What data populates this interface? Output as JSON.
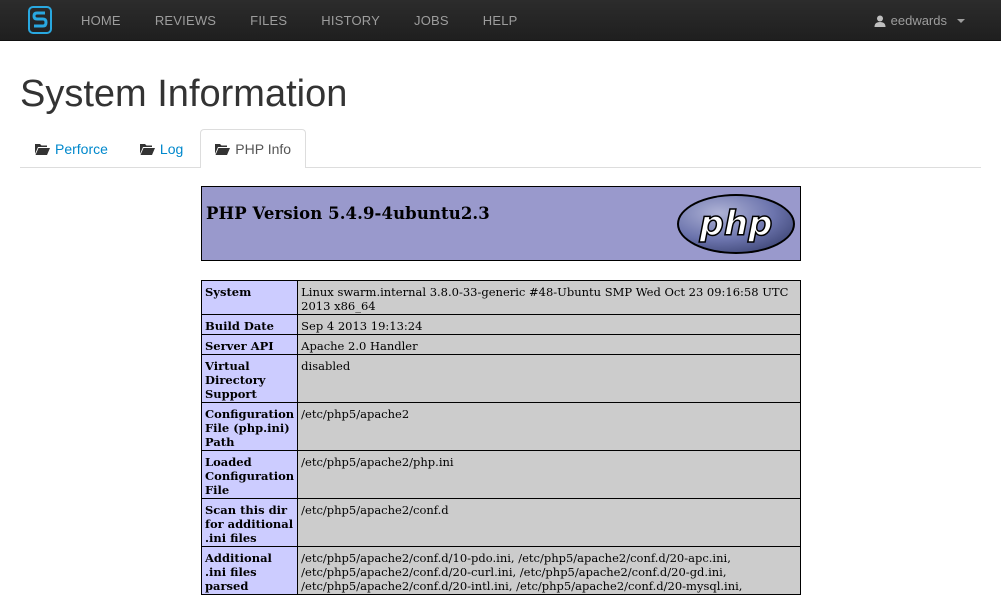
{
  "navbar": {
    "brand": "Swarm",
    "items": [
      "HOME",
      "REVIEWS",
      "FILES",
      "HISTORY",
      "JOBS",
      "HELP"
    ],
    "user": "eedwards"
  },
  "page": {
    "title": "System Information"
  },
  "tabs": [
    {
      "label": "Perforce",
      "icon": "folder-open-icon",
      "active": false
    },
    {
      "label": "Log",
      "icon": "folder-open-icon",
      "active": false
    },
    {
      "label": "PHP Info",
      "icon": "folder-open-icon",
      "active": true
    }
  ],
  "phpinfo": {
    "version_title": "PHP Version 5.4.9-4ubuntu2.3",
    "logo_text": "php",
    "rows": [
      {
        "key": "System",
        "value": "Linux swarm.internal 3.8.0-33-generic #48-Ubuntu SMP Wed Oct 23 09:16:58 UTC 2013 x86_64"
      },
      {
        "key": "Build Date",
        "value": "Sep 4 2013 19:13:24"
      },
      {
        "key": "Server API",
        "value": "Apache 2.0 Handler"
      },
      {
        "key": "Virtual Directory Support",
        "value": "disabled"
      },
      {
        "key": "Configuration File (php.ini) Path",
        "value": "/etc/php5/apache2"
      },
      {
        "key": "Loaded Configuration File",
        "value": "/etc/php5/apache2/php.ini"
      },
      {
        "key": "Scan this dir for additional .ini files",
        "value": "/etc/php5/apache2/conf.d"
      },
      {
        "key": "Additional .ini files parsed",
        "value": "/etc/php5/apache2/conf.d/10-pdo.ini, /etc/php5/apache2/conf.d/20-apc.ini, /etc/php5/apache2/conf.d/20-curl.ini, /etc/php5/apache2/conf.d/20-gd.ini, /etc/php5/apache2/conf.d/20-intl.ini, /etc/php5/apache2/conf.d/20-mysql.ini,"
      }
    ]
  },
  "colors": {
    "navbar_bg": "#222222",
    "link": "#0088cc",
    "php_header_bg": "#9999cc",
    "php_key_bg": "#ccccff",
    "php_value_bg": "#cccccc"
  }
}
